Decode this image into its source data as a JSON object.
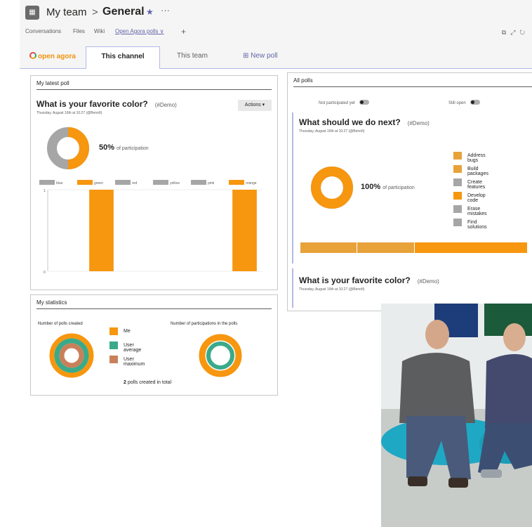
{
  "header": {
    "team": "My team",
    "separator": ">",
    "channel": "General",
    "star": "★",
    "more": "···"
  },
  "tabs": [
    {
      "label": "Conversations"
    },
    {
      "label": "Files"
    },
    {
      "label": "Wiki"
    },
    {
      "label": "Open Agora polls ∨"
    }
  ],
  "tab_add": "+",
  "app": {
    "brand": "open agora",
    "tabs": {
      "this_channel": "This channel",
      "this_team": "This team",
      "new_poll": "New poll"
    }
  },
  "latest": {
    "header": "My latest poll",
    "title": "What is your favorite color?",
    "tag": "(#Demo)",
    "meta": "Thursday, August 16th at 10:27 (@Benoît)",
    "actions": "Actions ▾",
    "participation_pct": "50%",
    "participation_text": "of participation",
    "chart_data": {
      "type": "bar",
      "categories": [
        "blue",
        "green",
        "red",
        "yellow",
        "pink",
        "orange"
      ],
      "values": [
        0,
        1,
        0,
        0,
        0,
        1
      ],
      "colors": [
        "#a6a6a6",
        "#f7960f",
        "#a6a6a6",
        "#a6a6a6",
        "#a6a6a6",
        "#f7960f"
      ],
      "ylim": [
        0,
        1
      ],
      "yticks": [
        "1",
        "0"
      ]
    }
  },
  "all": {
    "header": "All polls",
    "filter_participated": "Not participated yet",
    "filter_open": "Still open",
    "poll1": {
      "title": "What should we do next?",
      "tag": "(#Demo)",
      "meta": "Thursday, August 16th at 10:27 (@Benoît)",
      "participation_pct": "100%",
      "participation_text": "of participation",
      "legend": [
        {
          "label": "Address bugs",
          "color": "#e8a23a"
        },
        {
          "label": "Build packages",
          "color": "#e8a23a"
        },
        {
          "label": "Create features",
          "color": "#a6a6a6"
        },
        {
          "label": "Develop code",
          "color": "#f7960f"
        },
        {
          "label": "Erase mistakes",
          "color": "#a6a6a6"
        },
        {
          "label": "Find solutions",
          "color": "#a6a6a6"
        }
      ],
      "bar_segments": [
        {
          "label": "Address bugs",
          "share": 0.25,
          "color": "#e8a23a"
        },
        {
          "label": "Build packages",
          "share": 0.25,
          "color": "#e8a23a"
        },
        {
          "label": "Develop code",
          "share": 0.5,
          "color": "#f7960f"
        }
      ]
    },
    "poll2": {
      "title": "What is your favorite color?",
      "tag": "(#Demo)",
      "meta": "Thursday, August 16th at 10:27 (@Benoît)"
    }
  },
  "stats": {
    "header": "My statistics",
    "polls_created_label": "Number of polls created",
    "participations_label": "Number of participations in the polls",
    "legend": [
      {
        "label": "Me",
        "color": "#f7960f"
      },
      {
        "label": "User average",
        "color": "#3aaa8a"
      },
      {
        "label": "User maximum",
        "color": "#c9805a"
      }
    ],
    "total_count": "2",
    "total_text": "polls created in total"
  },
  "colors": {
    "accent": "#6264a7",
    "orange": "#f7960f",
    "grey": "#a6a6a6"
  }
}
